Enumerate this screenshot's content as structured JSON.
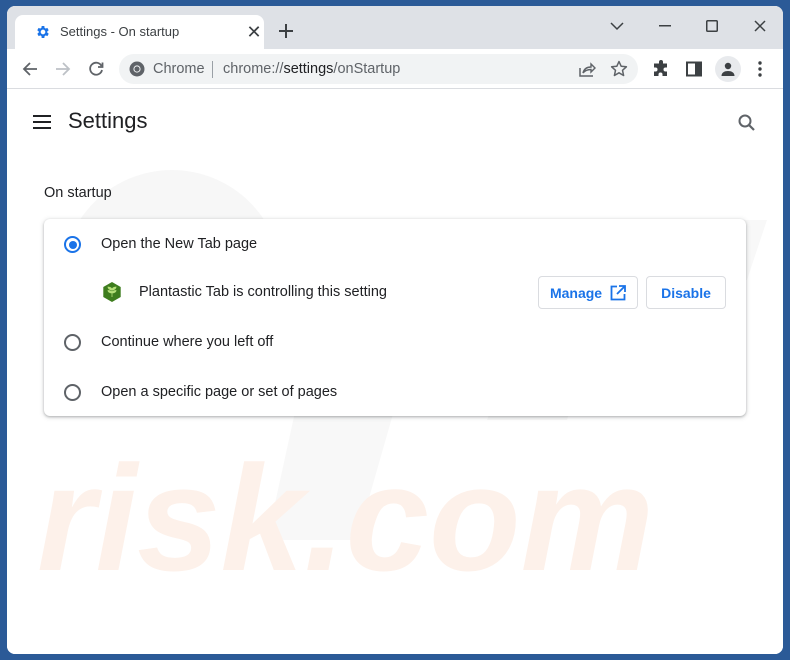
{
  "browser": {
    "tab": {
      "title": "Settings - On startup",
      "favicon": "gear-icon"
    },
    "window_controls": [
      "tab-search",
      "minimize",
      "maximize",
      "close"
    ],
    "omnibox": {
      "chip_label": "Chrome",
      "url_prefix": "chrome://",
      "url_host": "settings",
      "url_path": "/onStartup"
    },
    "toolbar_icons": [
      "back-icon",
      "forward-icon",
      "reload-icon",
      "share-icon",
      "bookmark-star-icon",
      "extensions-icon",
      "side-panel-icon",
      "profile-icon",
      "more-menu-icon"
    ]
  },
  "settings": {
    "page_title": "Settings",
    "section_title": "On startup",
    "options": [
      {
        "label": "Open the New Tab page",
        "checked": true
      },
      {
        "label": "Continue where you left off",
        "checked": false
      },
      {
        "label": "Open a specific page or set of pages",
        "checked": false
      }
    ],
    "extension_notice": {
      "text": "Plantastic Tab is controlling this setting",
      "manage_label": "Manage",
      "disable_label": "Disable"
    }
  },
  "colors": {
    "accent": "#1a73e8",
    "desktop": "#2b5a97",
    "tabstrip": "#dee1e6",
    "extension_green": "#3e7d1e"
  }
}
